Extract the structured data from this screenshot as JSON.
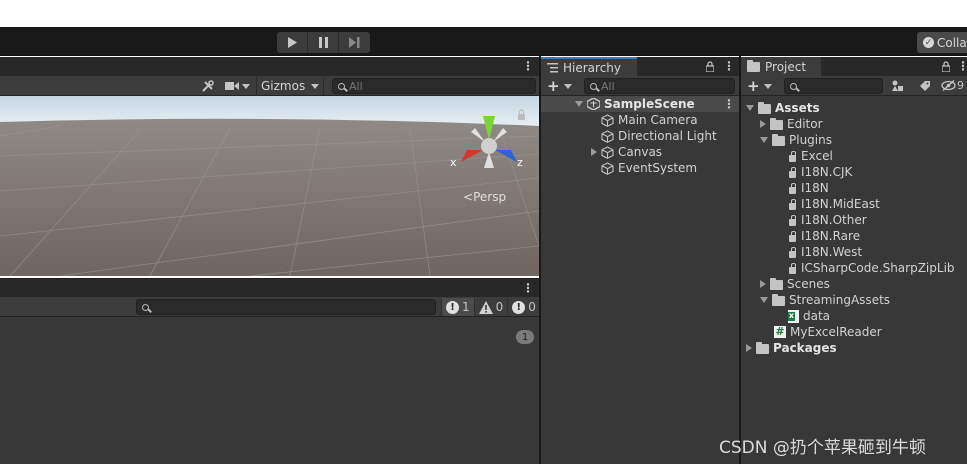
{
  "toolbar": {
    "play_icon": "play-icon",
    "pause_icon": "pause-icon",
    "step_icon": "step-icon",
    "collab_label": "Colla"
  },
  "scene": {
    "gizmos_label": "Gizmos",
    "search_placeholder": "All",
    "persp_label": "Persp",
    "axis_x": "x",
    "axis_z": "z"
  },
  "console": {
    "counts": {
      "log": "1",
      "warning": "0",
      "error": "0"
    },
    "collapse_count": "1"
  },
  "hierarchy": {
    "tab_label": "Hierarchy",
    "search_placeholder": "All",
    "scene_name": "SampleScene",
    "items": [
      {
        "label": "Main Camera"
      },
      {
        "label": "Directional Light"
      },
      {
        "label": "Canvas"
      },
      {
        "label": "EventSystem"
      }
    ]
  },
  "project": {
    "tab_label": "Project",
    "hidden_count": "9",
    "tree": [
      {
        "label": "Assets",
        "icon": "folder-icon"
      },
      {
        "label": "Editor",
        "icon": "folder-icon"
      },
      {
        "label": "Plugins",
        "icon": "folder-icon"
      },
      {
        "label": "Excel",
        "icon": "assembly-icon"
      },
      {
        "label": "I18N.CJK",
        "icon": "assembly-icon"
      },
      {
        "label": "I18N",
        "icon": "assembly-icon"
      },
      {
        "label": "I18N.MidEast",
        "icon": "assembly-icon"
      },
      {
        "label": "I18N.Other",
        "icon": "assembly-icon"
      },
      {
        "label": "I18N.Rare",
        "icon": "assembly-icon"
      },
      {
        "label": "I18N.West",
        "icon": "assembly-icon"
      },
      {
        "label": "ICSharpCode.SharpZipLib",
        "icon": "assembly-icon"
      },
      {
        "label": "Scenes",
        "icon": "folder-icon"
      },
      {
        "label": "StreamingAssets",
        "icon": "folder-icon"
      },
      {
        "label": "data",
        "icon": "excel-file-icon"
      },
      {
        "label": "MyExcelReader",
        "icon": "csharp-script-icon"
      },
      {
        "label": "Packages",
        "icon": "folder-icon"
      }
    ]
  },
  "watermark": "CSDN @扔个苹果砸到牛顿"
}
